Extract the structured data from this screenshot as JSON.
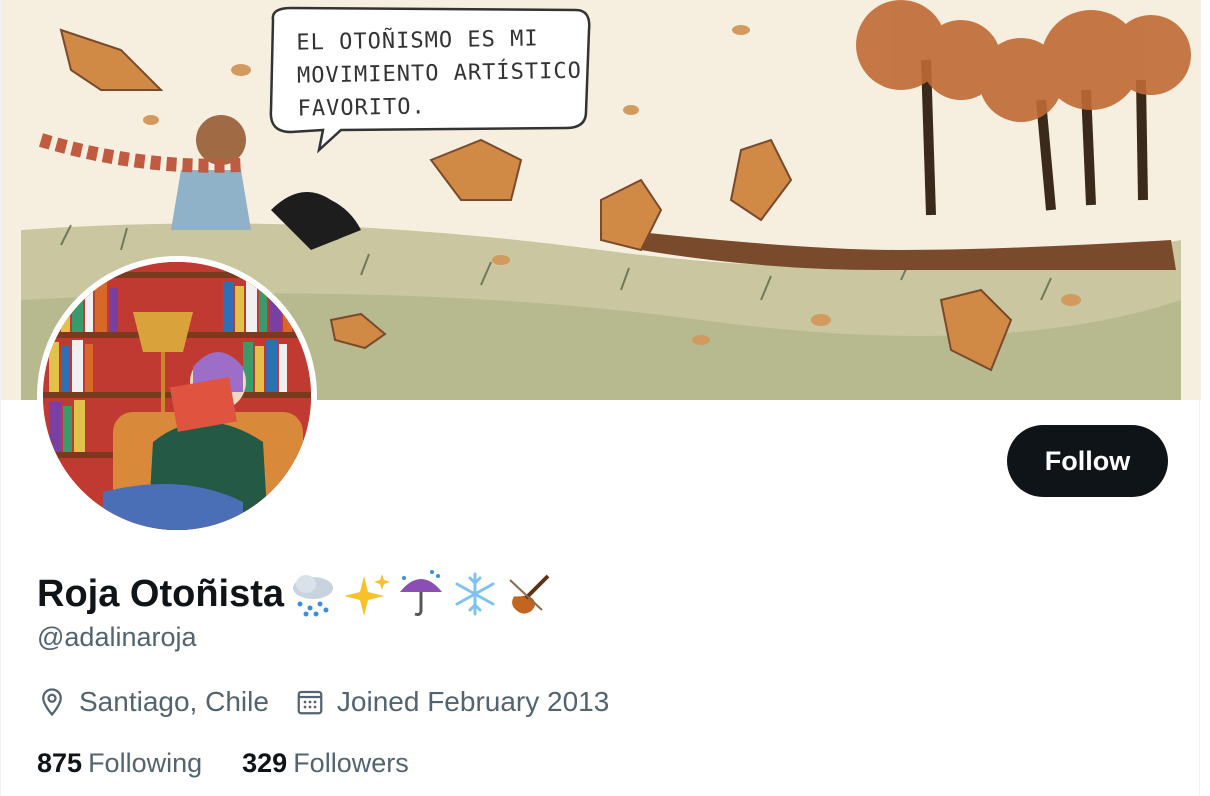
{
  "banner": {
    "speech_bubble": "EL OTOÑISMO ES MI\nMOVIMIENTO ARTÍSTICO\nFAVORITO."
  },
  "profile": {
    "display_name": "Roja Otoñista",
    "name_emojis": [
      "rain-cloud",
      "sparkles",
      "umbrella-with-rain",
      "snowflake",
      "violin"
    ],
    "handle": "@adalinaroja",
    "location": "Santiago, Chile",
    "joined": "Joined February 2013",
    "following_count": "875",
    "following_label": "Following",
    "followers_count": "329",
    "followers_label": "Followers"
  },
  "actions": {
    "follow_label": "Follow"
  },
  "colors": {
    "button_bg": "#0f1419",
    "secondary_text": "#536471",
    "banner_bg": "#f6efe0"
  },
  "icons": {
    "location": "location-pin-icon",
    "calendar": "calendar-icon"
  }
}
